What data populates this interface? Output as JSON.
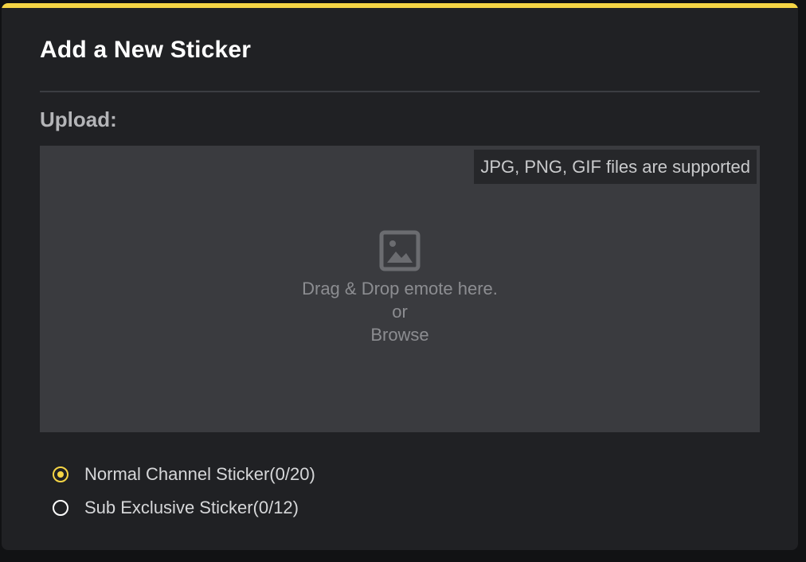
{
  "modal": {
    "title": "Add a New Sticker",
    "accent_color": "#f5d545"
  },
  "upload": {
    "label": "Upload:",
    "format_note": "JPG, PNG, GIF files are supported",
    "icon": "image-icon",
    "drop_hint": "Drag & Drop emote here.",
    "or_text": "or",
    "browse_label": "Browse"
  },
  "sticker_type": {
    "options": [
      {
        "label": "Normal Channel Sticker(0/20)",
        "selected": true
      },
      {
        "label": "Sub Exclusive Sticker(0/12)",
        "selected": false
      }
    ]
  }
}
